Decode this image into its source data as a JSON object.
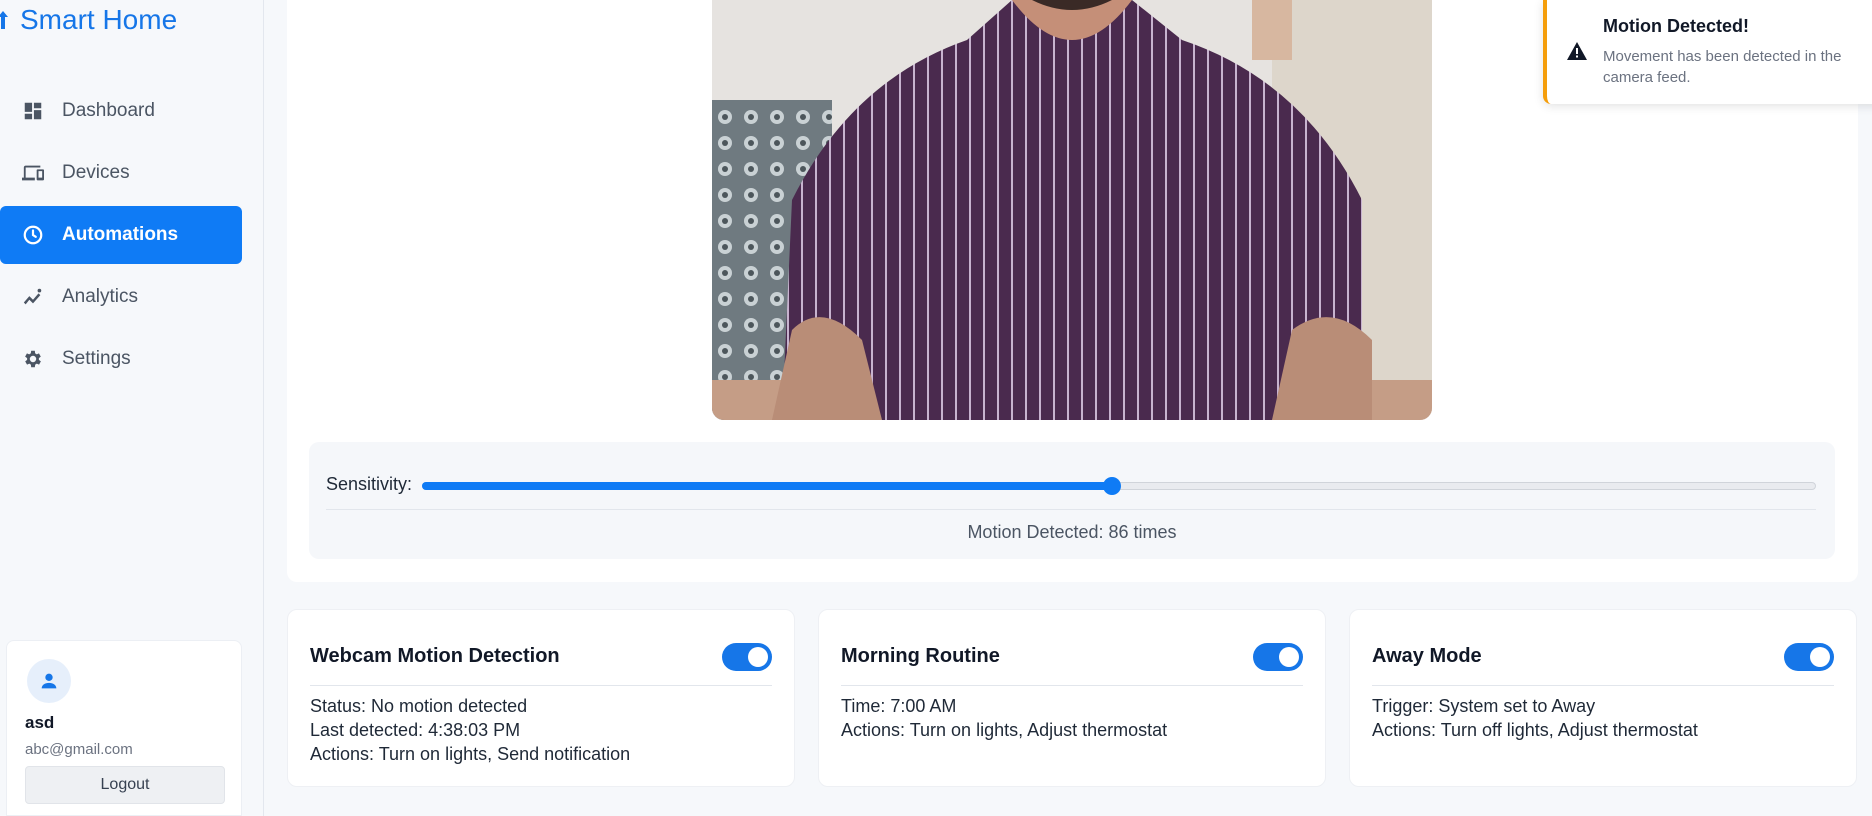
{
  "app": {
    "title": "Smart Home"
  },
  "sidebar": {
    "items": [
      {
        "label": "Dashboard",
        "icon": "dashboard-icon"
      },
      {
        "label": "Devices",
        "icon": "devices-icon"
      },
      {
        "label": "Automations",
        "icon": "clock-icon",
        "active": true
      },
      {
        "label": "Analytics",
        "icon": "analytics-icon"
      },
      {
        "label": "Settings",
        "icon": "gear-icon"
      }
    ]
  },
  "user": {
    "name": "asd",
    "email": "abc@gmail.com",
    "logout_label": "Logout"
  },
  "camera": {
    "sensitivity_label": "Sensitivity:",
    "sensitivity_level": 0.495,
    "motion_count_text": "Motion Detected: 86 times"
  },
  "toast": {
    "title": "Motion Detected!",
    "message": "Movement has been detected in the camera feed.",
    "accent_color": "#f59e0b"
  },
  "automations": [
    {
      "title": "Webcam Motion Detection",
      "enabled": true,
      "lines": [
        "Status: No motion detected",
        "Last detected: 4:38:03 PM",
        "Actions: Turn on lights, Send notification"
      ]
    },
    {
      "title": "Morning Routine",
      "enabled": true,
      "lines": [
        "Time: 7:00 AM",
        "Actions: Turn on lights, Adjust thermostat"
      ]
    },
    {
      "title": "Away Mode",
      "enabled": true,
      "lines": [
        "Trigger: System set to Away",
        "Actions: Turn off lights, Adjust thermostat"
      ]
    }
  ],
  "colors": {
    "accent": "#0f7bf5",
    "brand": "#1676e8"
  }
}
